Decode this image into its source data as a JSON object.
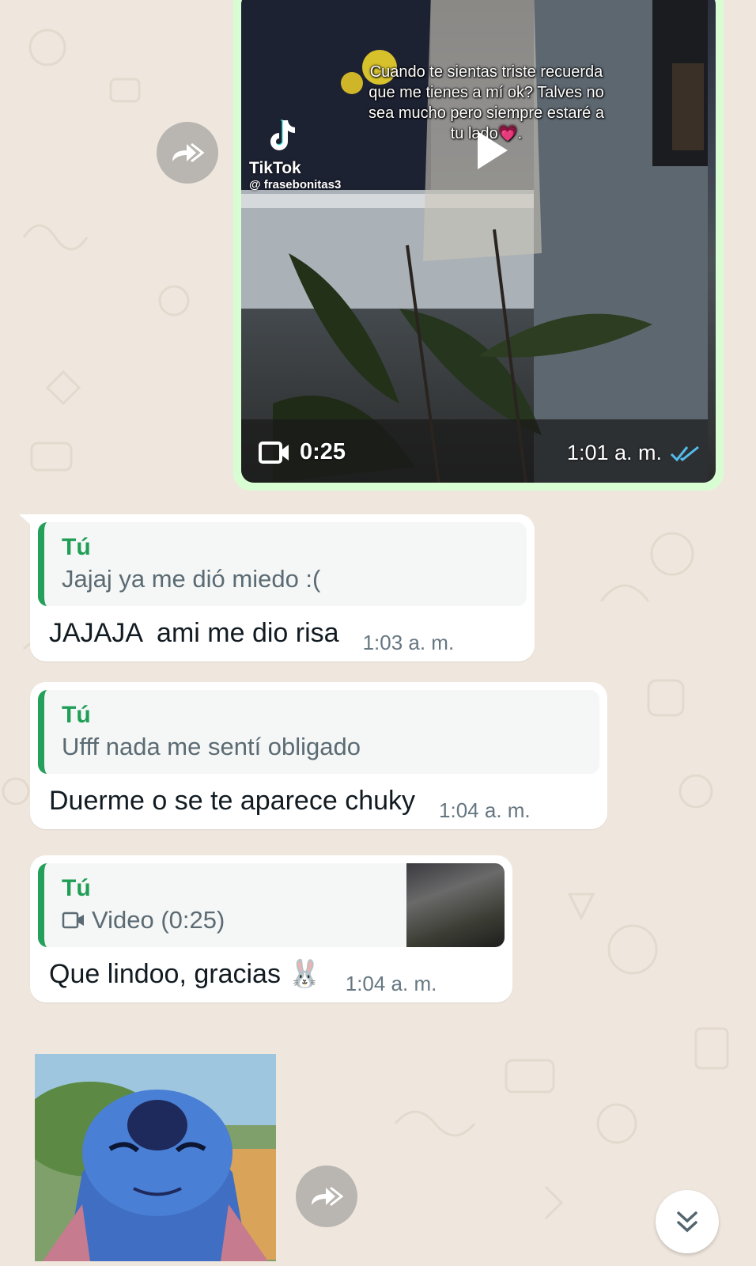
{
  "video_message": {
    "caption": "Cuando te sientas triste recuerda que me tienes a mí ok? Talves no sea mucho pero siempre estaré a tu lado💗.",
    "tiktok_brand": "TikTok",
    "tiktok_user": "@ frasebonitas3",
    "duration": "0:25",
    "time": "1:01 a. m.",
    "status_icon": "double-check-read-icon",
    "colors": {
      "bubble": "#d9fdd3",
      "check": "#53bdeb"
    }
  },
  "messages": [
    {
      "quote_author": "Tú",
      "quote_text": "Jajaj ya me dió miedo :(",
      "text": "JAJAJA  ami me dio risa",
      "time": "1:03 a. m."
    },
    {
      "quote_author": "Tú",
      "quote_text": "Ufff nada me sentí obligado",
      "text": "Duerme o se te aparece chuky",
      "time": "1:04 a. m."
    },
    {
      "quote_author": "Tú",
      "quote_text": "Video (0:25)",
      "quote_icon": "video-camera-icon",
      "text": "Que lindoo, gracias 🐰",
      "time": "1:04 a. m."
    }
  ],
  "sticker": {
    "description_icon": "stitch-sticker"
  },
  "colors": {
    "background": "#efe7de",
    "quote_bar": "#25a05b",
    "quote_author": "#1f9e55"
  }
}
